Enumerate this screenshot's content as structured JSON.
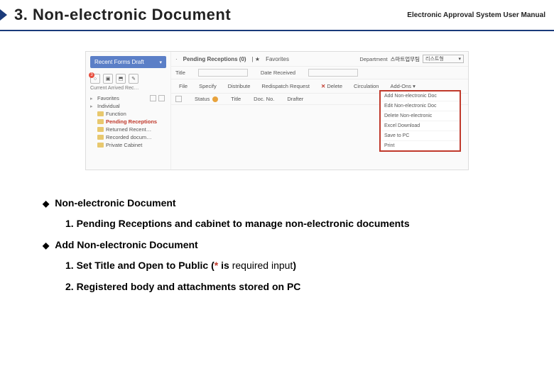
{
  "header": {
    "page_title": "3. Non-electronic Document",
    "doc_title": "Electronic Approval System User Manual"
  },
  "screenshot": {
    "btn_recent": "Recent Forms Draft",
    "badge": "3",
    "side_label": "Current Arrived Rec…",
    "fav": "Favorites",
    "indiv": "Individual",
    "tree": {
      "function": "Function",
      "pending": "Pending Receptions",
      "returned": "Returned Recent…",
      "recorded": "Recorded docum…",
      "private": "Private Cabinet"
    },
    "top": {
      "pending_label": "Pending Receptions (0)",
      "favorites": "Favorites",
      "dept_label": "Department",
      "dept_value": "스마트업무팀",
      "dd_value": "리스트형"
    },
    "filter": {
      "title": "Title",
      "date": "Date Received"
    },
    "toolbar": {
      "file": "File",
      "specify": "Specify",
      "distribute": "Distribute",
      "redispatch": "Redispatch Request",
      "delete": "Delete",
      "circulation": "Circulation",
      "addons": "Add-Ons ▾"
    },
    "addons": {
      "items": [
        "Add Non-electronic Doc",
        "Edit Non-electronic Doc",
        "Delete Non-electronic",
        "Excel Download",
        "Save to PC",
        "Print"
      ]
    },
    "table": {
      "status": "Status",
      "title": "Title",
      "doc_no": "Doc. No.",
      "drafter": "Drafter"
    }
  },
  "content": {
    "h1": "Non-electronic Document",
    "p1": "1. Pending Receptions and cabinet to manage non-electronic documents",
    "h2": "Add Non-electronic Document",
    "p2_pre": "1. Set Title and Open to Public (",
    "p2_star": "*",
    "p2_mid": " is ",
    "p2_req": "required input",
    "p2_post": ")",
    "p3": "2. Registered body and attachments stored on PC"
  }
}
